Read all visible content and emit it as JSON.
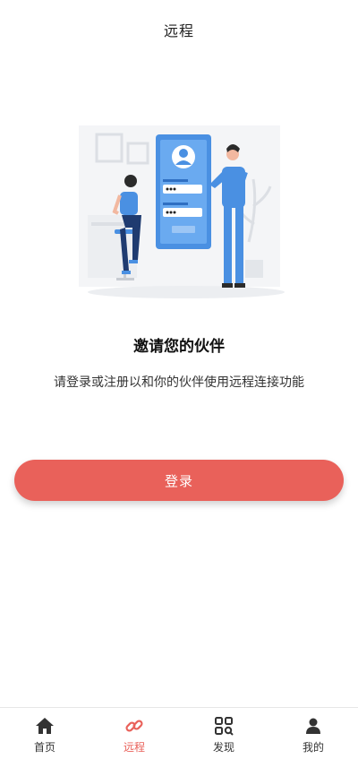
{
  "header": {
    "title": "远程"
  },
  "main": {
    "heading": "邀请您的伙伴",
    "subtitle": "请登录或注册以和你的伙伴使用远程连接功能",
    "login_label": "登录"
  },
  "tabbar": {
    "items": [
      {
        "label": "首页",
        "icon": "home-icon"
      },
      {
        "label": "远程",
        "icon": "link-icon",
        "active": true
      },
      {
        "label": "发现",
        "icon": "grid-search-icon"
      },
      {
        "label": "我的",
        "icon": "user-icon"
      }
    ]
  },
  "colors": {
    "accent": "#e9615a",
    "illustration_blue": "#4a90e2",
    "text_dark": "#333333"
  }
}
